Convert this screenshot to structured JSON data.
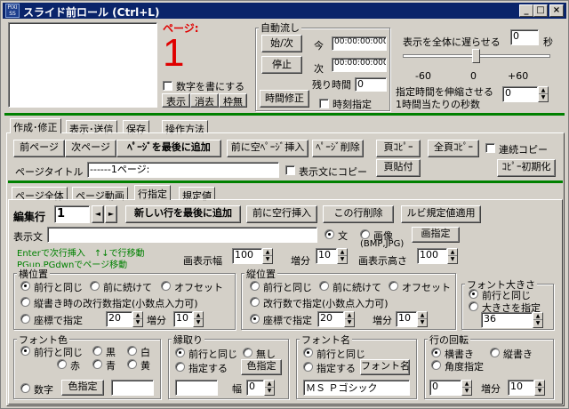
{
  "window": {
    "title": "スライド前ロール (Ctrl+L)",
    "icon_text": "PIXI SS",
    "min": "_",
    "max": "□",
    "close": "×"
  },
  "page": {
    "label": "ページ:",
    "number": "1",
    "show_number": "数字を書にする",
    "btn_show": "表示",
    "btn_erase": "消去",
    "btn_frame": "枠無"
  },
  "auto": {
    "title": "自動流し",
    "start": "始/次",
    "stop": "停止",
    "now": "今",
    "next": "次",
    "remain": "残り時間",
    "time_now": "00:00:00:000",
    "time_next": "00:00:00:000",
    "remain_val": "0",
    "fix_time": "時間修正",
    "time_specify": "時刻指定"
  },
  "delay": {
    "label": "表示を全体に遅らせる",
    "value": "0",
    "unit": "秒",
    "tick_neg": "-60",
    "tick_zero": "0",
    "tick_pos": "+60",
    "stretch1": "指定時間を伸縮させる",
    "stretch2": "1時間当たりの秒数",
    "stretch_val": "0"
  },
  "main_tabs": [
    "作成･修正",
    "表示･送信",
    "保存",
    "操作方法"
  ],
  "edit": {
    "prev": "前ページ",
    "next": "次ページ",
    "add_last": "ﾍﾟｰｼﾞを最後に追加",
    "insert_before": "前に空ﾍﾟｰｼﾞ挿入",
    "delete": "ﾍﾟｰｼﾞ削除",
    "copy": "頁ｺﾋﾟｰ",
    "copy_all": "全頁ｺﾋﾟｰ",
    "continuous": "連続コピー",
    "page_title_label": "ページタイトル",
    "page_title_value": "------1ページ:",
    "copy_to_display": "表示文にコピー",
    "paste": "頁貼付",
    "copy_init": "ｺﾋﾟｰ初期化"
  },
  "sub_tabs": [
    "ページ全体",
    "ページ動画",
    "行指定",
    "規定値"
  ],
  "line": {
    "edit_row": "編集行",
    "row_val": "1",
    "prev_arrow": "◄",
    "next_arrow": "►",
    "add_row": "新しい行を最後に追加",
    "insert_row": "前に空行挿入",
    "delete_row": "この行削除",
    "ruby": "ルビ規定値適用",
    "display_text": "表示文",
    "display_value": "",
    "radio_text": "文",
    "radio_image": "画像",
    "image_types": "(BMP,JPG)",
    "image_spec": "画指定",
    "hint1": "Enterで次行挿入　↑↓で行移動",
    "hint2": "PGup,PGdwnでページ移動",
    "img_width": "画表示幅",
    "img_width_val": "100",
    "inc": "増分",
    "inc_val": "10",
    "img_height": "画表示高さ",
    "img_height_val": "100"
  },
  "hpos": {
    "title": "横位置",
    "same": "前行と同じ",
    "cont": "前に続けて",
    "offset": "オフセット",
    "vertical": "縦書き時の改行数指定(小数点入力可)",
    "coord": "座標で指定",
    "coord_val": "20",
    "inc": "増分",
    "inc_val": "10"
  },
  "vpos": {
    "title": "縦位置",
    "same": "前行と同じ",
    "cont": "前に続けて",
    "offset": "オフセット",
    "newline": "改行数で指定(小数点入力可)",
    "coord": "座標で指定",
    "coord_val": "20",
    "inc": "増分",
    "inc_val": "10"
  },
  "fsize": {
    "title": "フォント大きさ",
    "same": "前行と同じ",
    "specify": "大きさを指定",
    "value": "36"
  },
  "fcolor": {
    "title": "フォント色",
    "same": "前行と同じ",
    "black": "黒",
    "white": "白",
    "red": "赤",
    "blue": "青",
    "yellow": "黄",
    "number": "数字",
    "specify": "色指定"
  },
  "border": {
    "title": "縁取り",
    "same": "前行と同じ",
    "none": "無し",
    "specify": "指定する",
    "color": "色指定",
    "width": "幅",
    "width_val": "0"
  },
  "fname": {
    "title": "フォント名",
    "same": "前行と同じ",
    "specify": "指定する",
    "btn": "フォント名",
    "value": "ＭＳ Ｐゴシック"
  },
  "rotate": {
    "title": "行の回転",
    "horizontal": "横書き",
    "vertical": "縦書き",
    "angle": "角度指定",
    "angle_val": "0",
    "inc": "増分",
    "inc_val": "10"
  }
}
